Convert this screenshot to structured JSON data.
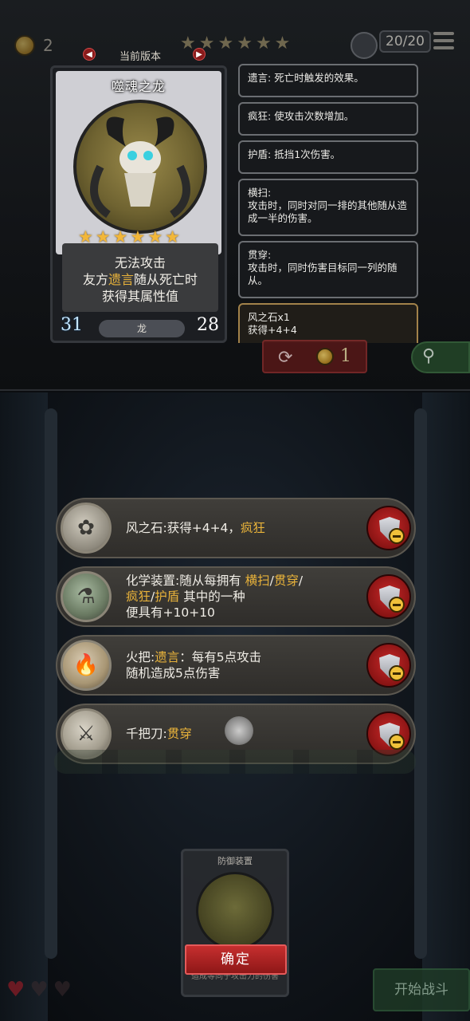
{
  "top_bar": {
    "coin_count": "2",
    "star_count": 6,
    "capacity": "20/20",
    "version_label": "当前版本"
  },
  "card": {
    "name": "噬魂之龙",
    "stars": 6,
    "description_prefix": "无法攻击",
    "description_line2_a": "友方",
    "description_line2_keyword": "遗言",
    "description_line2_b": "随从死亡时",
    "description_line3": "获得其属性值",
    "attack": "31",
    "tribe": "龙",
    "health": "28"
  },
  "keywords": [
    {
      "title": "遗言:",
      "text": "死亡时触发的效果。"
    },
    {
      "title": "疯狂:",
      "text": "使攻击次数增加。"
    },
    {
      "title": "护盾:",
      "text": "抵挡1次伤害。"
    },
    {
      "title": "横扫:",
      "text": "攻击时，同时对同一排的其他随从造成一半的伤害。"
    },
    {
      "title": "贯穿:",
      "text": "攻击时，同时伤害目标同一列的随从。"
    },
    {
      "title": "风之石x1",
      "text": "获得+4+4"
    }
  ],
  "refresh": {
    "price": "1"
  },
  "items": [
    {
      "name": "风之石",
      "segments": [
        {
          "t": "风之石:获得+4+4，",
          "hl": false
        },
        {
          "t": "疯狂",
          "hl": true
        }
      ]
    },
    {
      "name": "化学装置",
      "segments": [
        {
          "t": "化学装置:随从每拥有 ",
          "hl": false
        },
        {
          "t": "横扫",
          "hl": true
        },
        {
          "t": "/",
          "hl": false
        },
        {
          "t": "贯穿",
          "hl": true
        },
        {
          "t": "/\n",
          "hl": false
        },
        {
          "t": "疯狂",
          "hl": true
        },
        {
          "t": "/",
          "hl": false
        },
        {
          "t": "护盾",
          "hl": true
        },
        {
          "t": " 其中的一种\n便具有+10+10",
          "hl": false
        }
      ]
    },
    {
      "name": "火把",
      "segments": [
        {
          "t": "火把:",
          "hl": false
        },
        {
          "t": "遗言",
          "hl": true
        },
        {
          "t": "：每有5点攻击\n随机造成5点伤害",
          "hl": false
        }
      ]
    },
    {
      "name": "千把刀",
      "segments": [
        {
          "t": "千把刀:",
          "hl": false
        },
        {
          "t": "贯穿",
          "hl": true
        }
      ]
    }
  ],
  "bottom_card": {
    "title": "防御装置",
    "description": "造成等同于攻击力的伤害"
  },
  "confirm_label": "确定",
  "start_battle_label": "开始战斗",
  "lives": {
    "filled": 1,
    "total": 3
  },
  "colors": {
    "highlight": "#e8b23a",
    "danger": "#c62828",
    "panel": "#3a3b3d"
  }
}
